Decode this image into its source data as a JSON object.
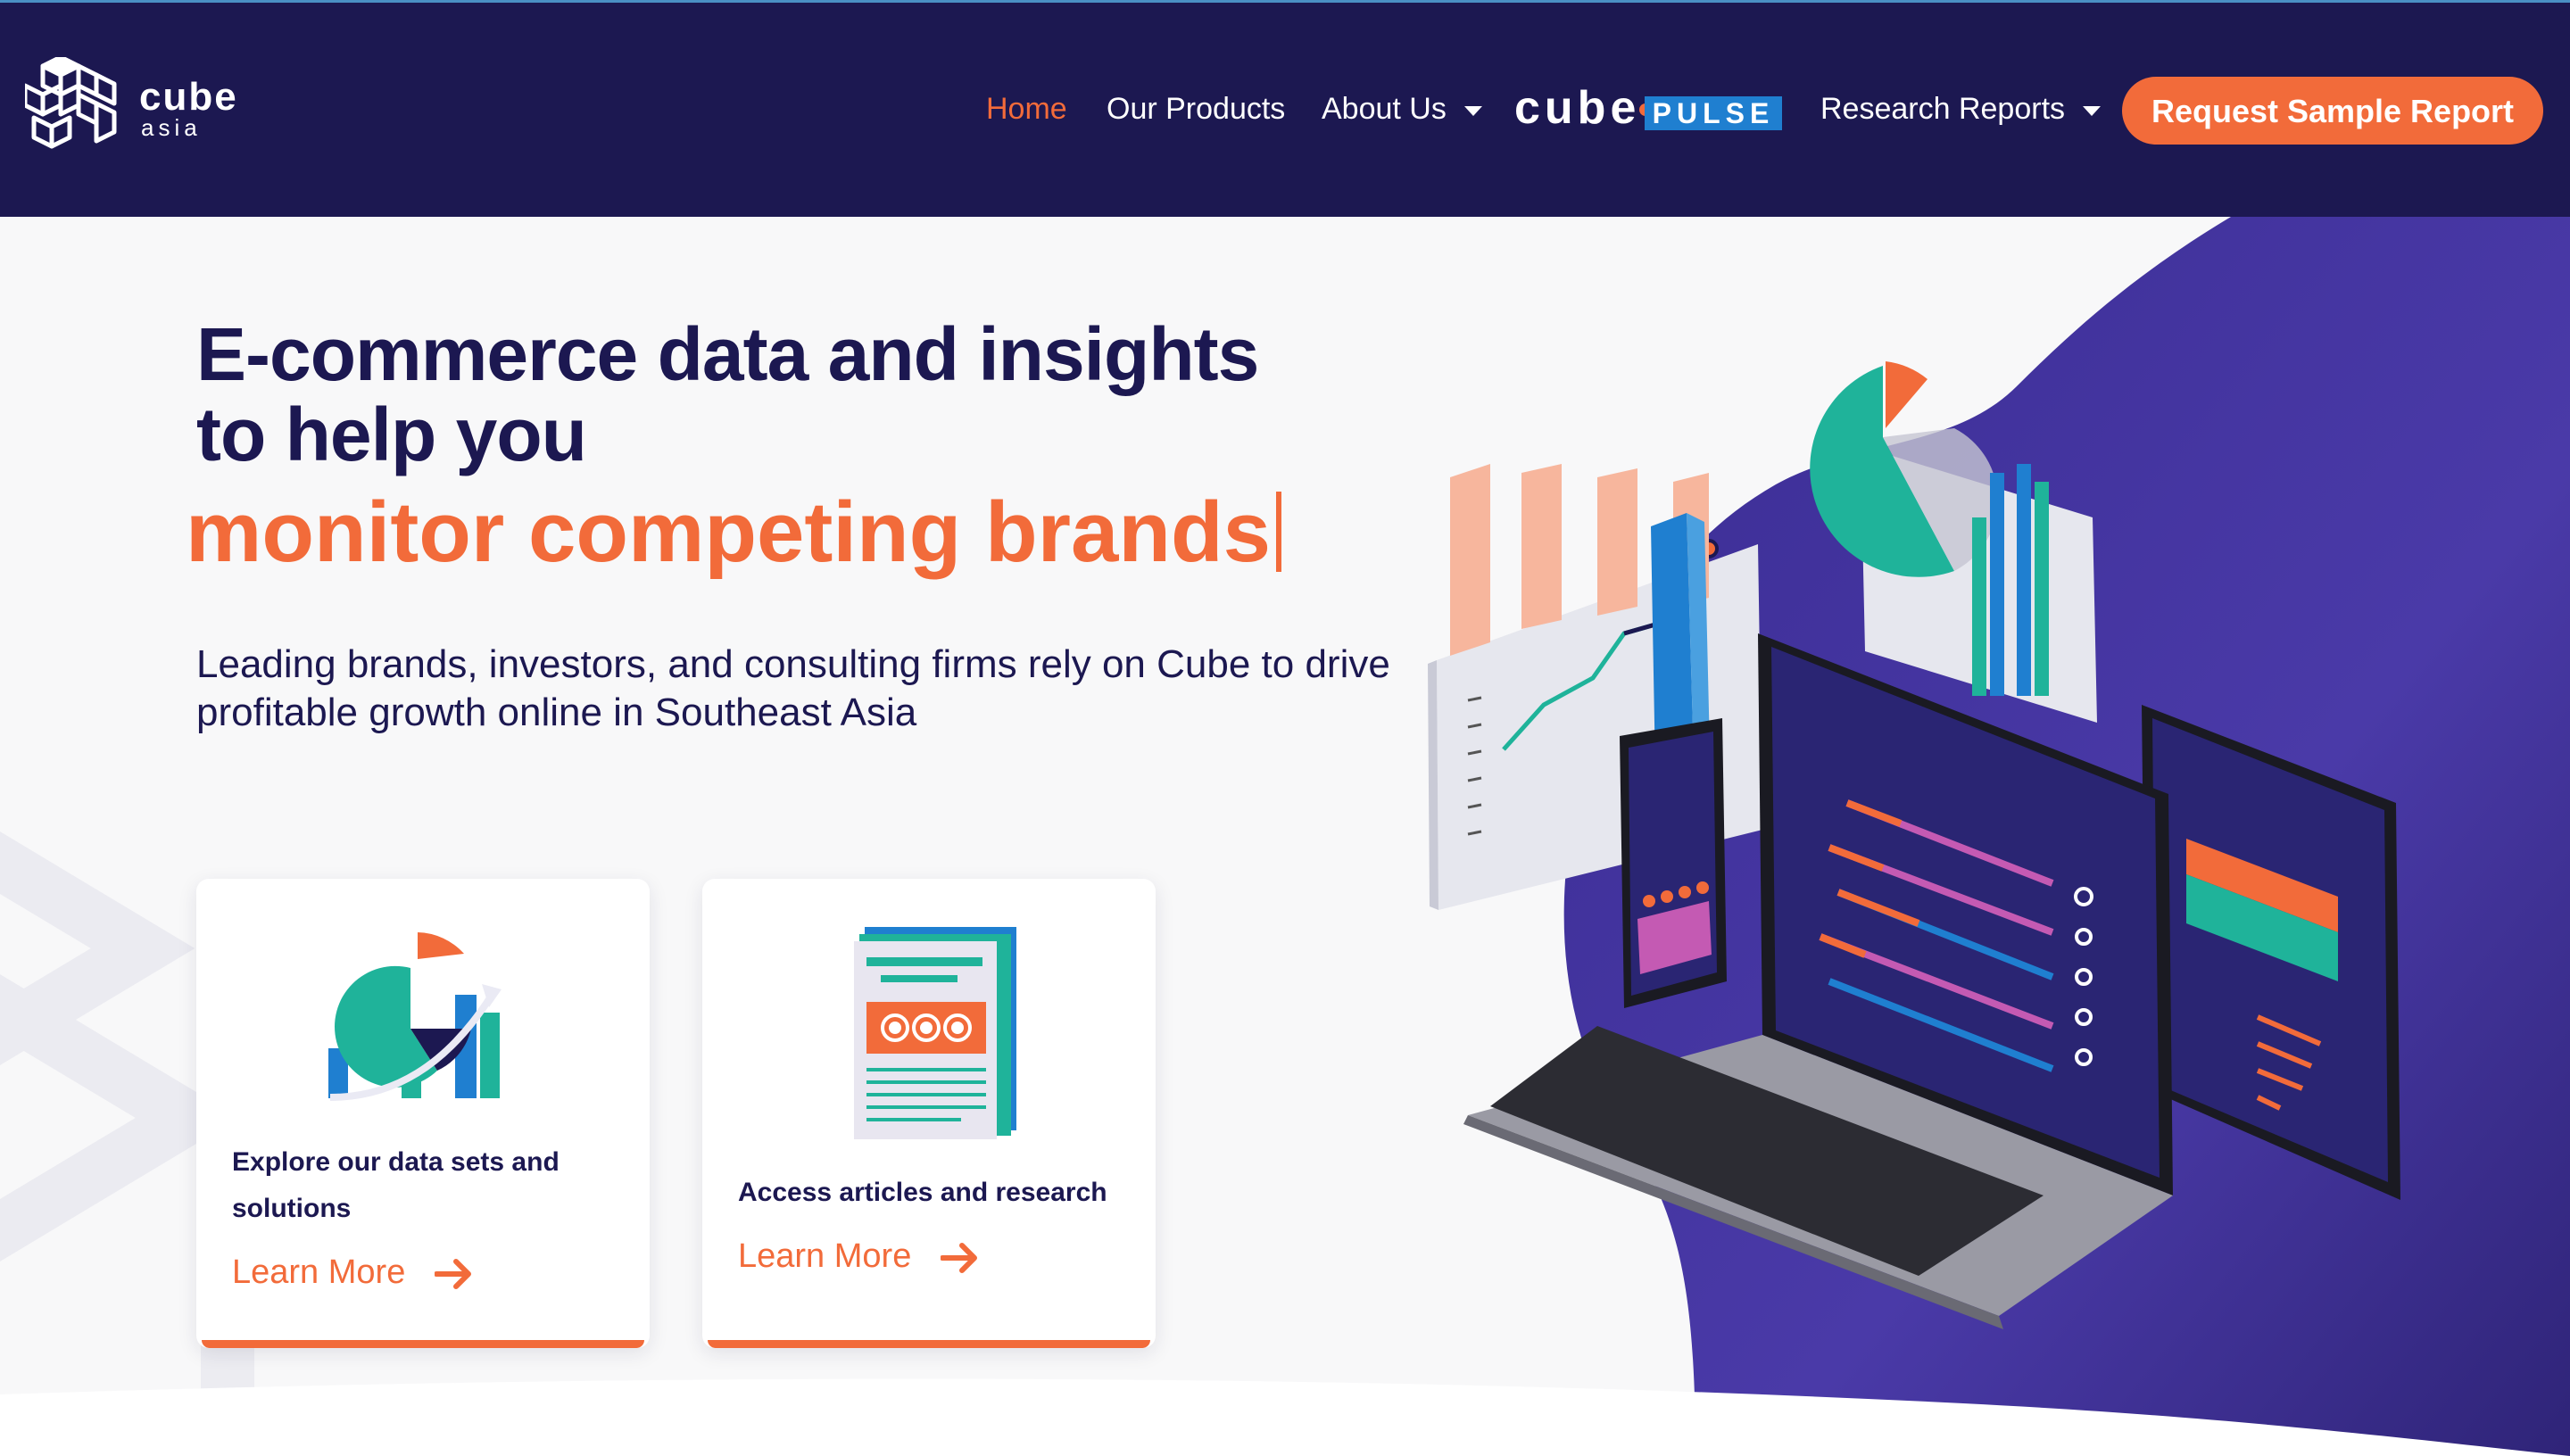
{
  "header": {
    "logo": {
      "word": "cube",
      "sub": "asia"
    },
    "nav": [
      {
        "label": "Home",
        "active": true
      },
      {
        "label": "Our Products"
      },
      {
        "label": "About Us",
        "dropdown": true
      },
      {
        "label": "Research Reports",
        "dropdown": true
      }
    ],
    "pulse_logo": {
      "word": "cube",
      "badge": "PULSE"
    },
    "cta_label": "Request Sample Report"
  },
  "hero": {
    "title": "E-commerce data and insights to help you",
    "rotating_text": "monitor competing brands",
    "description": "Leading brands, investors, and consulting firms rely on Cube to drive profitable growth online in Southeast Asia"
  },
  "cards": [
    {
      "text": "Explore our data sets and solutions",
      "link": "Learn More",
      "icon": "data-chart-icon"
    },
    {
      "text": "Access articles and research",
      "link": "Learn More",
      "icon": "document-report-icon"
    }
  ],
  "colors": {
    "navy": "#1c1851",
    "accent": "#f26b3a",
    "purple": "#3b2a8f",
    "teal": "#1fb39a",
    "blue": "#1f7fd0"
  }
}
